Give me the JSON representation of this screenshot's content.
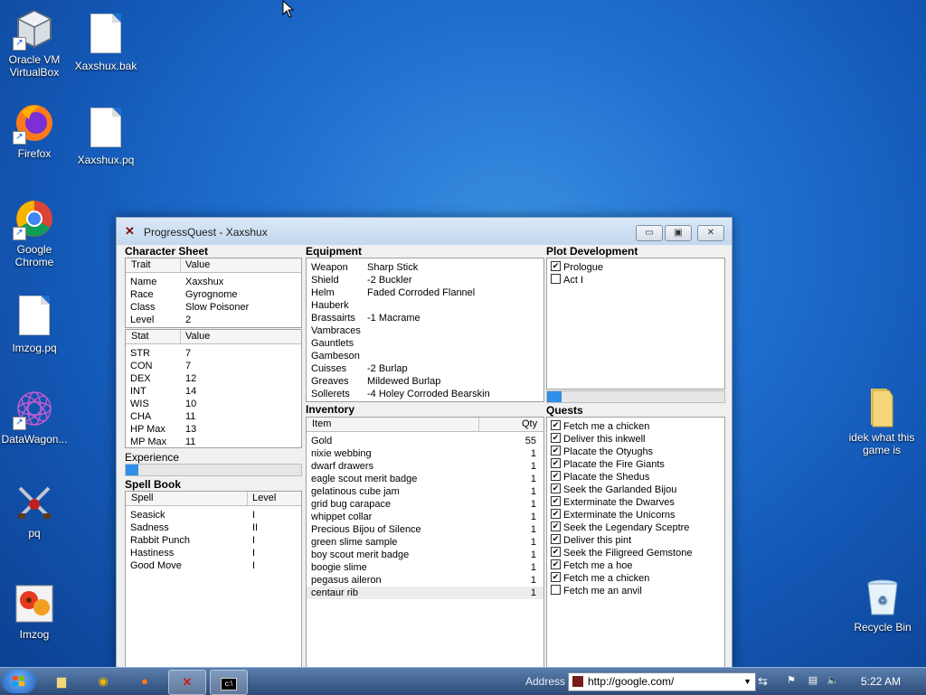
{
  "desktop": {
    "icons": [
      {
        "label": "Oracle VM VirtualBox",
        "icon": "virtualbox-icon"
      },
      {
        "label": "Xaxshux.bak",
        "icon": "file-icon"
      },
      {
        "label": "Firefox",
        "icon": "firefox-icon"
      },
      {
        "label": "Xaxshux.pq",
        "icon": "file-icon"
      },
      {
        "label": "Google Chrome",
        "icon": "chrome-icon"
      },
      {
        "label": "Imzog.pq",
        "icon": "file-icon"
      },
      {
        "label": "DataWagon...",
        "icon": "datawagon-icon"
      },
      {
        "label": "pq",
        "icon": "pq-icon"
      },
      {
        "label": "Imzog",
        "icon": "imzog-icon"
      },
      {
        "label": "idek what this game is",
        "icon": "folder-icon"
      },
      {
        "label": "Recycle Bin",
        "icon": "recycle-bin-icon"
      }
    ]
  },
  "window": {
    "title": "ProgressQuest - Xaxshux",
    "buttons": {
      "minimize": "▭",
      "maximize": "▣",
      "close": "✕"
    }
  },
  "character_sheet": {
    "header": "Character Sheet",
    "traits_columns": [
      "Trait",
      "Value"
    ],
    "traits": [
      [
        "Name",
        "Xaxshux"
      ],
      [
        "Race",
        "Gyrognome"
      ],
      [
        "Class",
        "Slow Poisoner"
      ],
      [
        "Level",
        "2"
      ]
    ],
    "stats_columns": [
      "Stat",
      "Value"
    ],
    "stats": [
      [
        "STR",
        "7"
      ],
      [
        "CON",
        "7"
      ],
      [
        "DEX",
        "12"
      ],
      [
        "INT",
        "14"
      ],
      [
        "WIS",
        "10"
      ],
      [
        "CHA",
        "11"
      ],
      [
        "HP Max",
        "13"
      ],
      [
        "MP Max",
        "11"
      ]
    ],
    "experience_label": "Experience",
    "experience_progress": 0.07
  },
  "spell_book": {
    "header": "Spell Book",
    "columns": [
      "Spell",
      "Level"
    ],
    "spells": [
      [
        "Seasick",
        "I"
      ],
      [
        "Sadness",
        "II"
      ],
      [
        "Rabbit Punch",
        "I"
      ],
      [
        "Hastiness",
        "I"
      ],
      [
        "Good Move",
        "I"
      ]
    ]
  },
  "equipment": {
    "header": "Equipment",
    "items": [
      [
        "Weapon",
        "Sharp Stick"
      ],
      [
        "Shield",
        "-2 Buckler"
      ],
      [
        "Helm",
        "Faded Corroded Flannel"
      ],
      [
        "Hauberk",
        ""
      ],
      [
        "Brassairts",
        "-1 Macrame"
      ],
      [
        "Vambraces",
        ""
      ],
      [
        "Gauntlets",
        ""
      ],
      [
        "Gambeson",
        ""
      ],
      [
        "Cuisses",
        "-2 Burlap"
      ],
      [
        "Greaves",
        "Mildewed Burlap"
      ],
      [
        "Sollerets",
        "-4 Holey Corroded Bearskin"
      ]
    ]
  },
  "inventory": {
    "header": "Inventory",
    "columns": [
      "Item",
      "Qty"
    ],
    "items": [
      [
        "Gold",
        "55"
      ],
      [
        "nixie webbing",
        "1"
      ],
      [
        "dwarf drawers",
        "1"
      ],
      [
        "eagle scout merit badge",
        "1"
      ],
      [
        "gelatinous cube jam",
        "1"
      ],
      [
        "grid bug carapace",
        "1"
      ],
      [
        "whippet collar",
        "1"
      ],
      [
        "Precious Bijou of Silence",
        "1"
      ],
      [
        "green slime sample",
        "1"
      ],
      [
        "boy scout merit badge",
        "1"
      ],
      [
        "boogie slime",
        "1"
      ],
      [
        "pegasus aileron",
        "1"
      ],
      [
        "centaur rib",
        "1"
      ]
    ]
  },
  "plot": {
    "header": "Plot Development",
    "acts": [
      {
        "label": "Prologue",
        "checked": true
      },
      {
        "label": "Act I",
        "checked": false
      }
    ],
    "progress": 0.08
  },
  "quests": {
    "header": "Quests",
    "items": [
      {
        "label": "Fetch me a chicken",
        "checked": true
      },
      {
        "label": "Deliver this inkwell",
        "checked": true
      },
      {
        "label": "Placate the Otyughs",
        "checked": true
      },
      {
        "label": "Placate the Fire Giants",
        "checked": true
      },
      {
        "label": "Placate the Shedus",
        "checked": true
      },
      {
        "label": "Seek the Garlanded Bijou",
        "checked": true
      },
      {
        "label": "Exterminate the Dwarves",
        "checked": true
      },
      {
        "label": "Exterminate the Unicorns",
        "checked": true
      },
      {
        "label": "Seek the Legendary Sceptre",
        "checked": true
      },
      {
        "label": "Deliver this pint",
        "checked": true
      },
      {
        "label": "Seek the Filigreed Gemstone",
        "checked": true
      },
      {
        "label": "Fetch me a hoe",
        "checked": true
      },
      {
        "label": "Fetch me a chicken",
        "checked": true
      },
      {
        "label": "Fetch me an anvil",
        "checked": false
      }
    ]
  },
  "taskbar": {
    "address_label": "Address",
    "address_value": "http://google.com/",
    "clock": "5:22 AM"
  },
  "colors": {
    "progress": "#2f8ee8",
    "desktop": "#1f6fcf"
  }
}
